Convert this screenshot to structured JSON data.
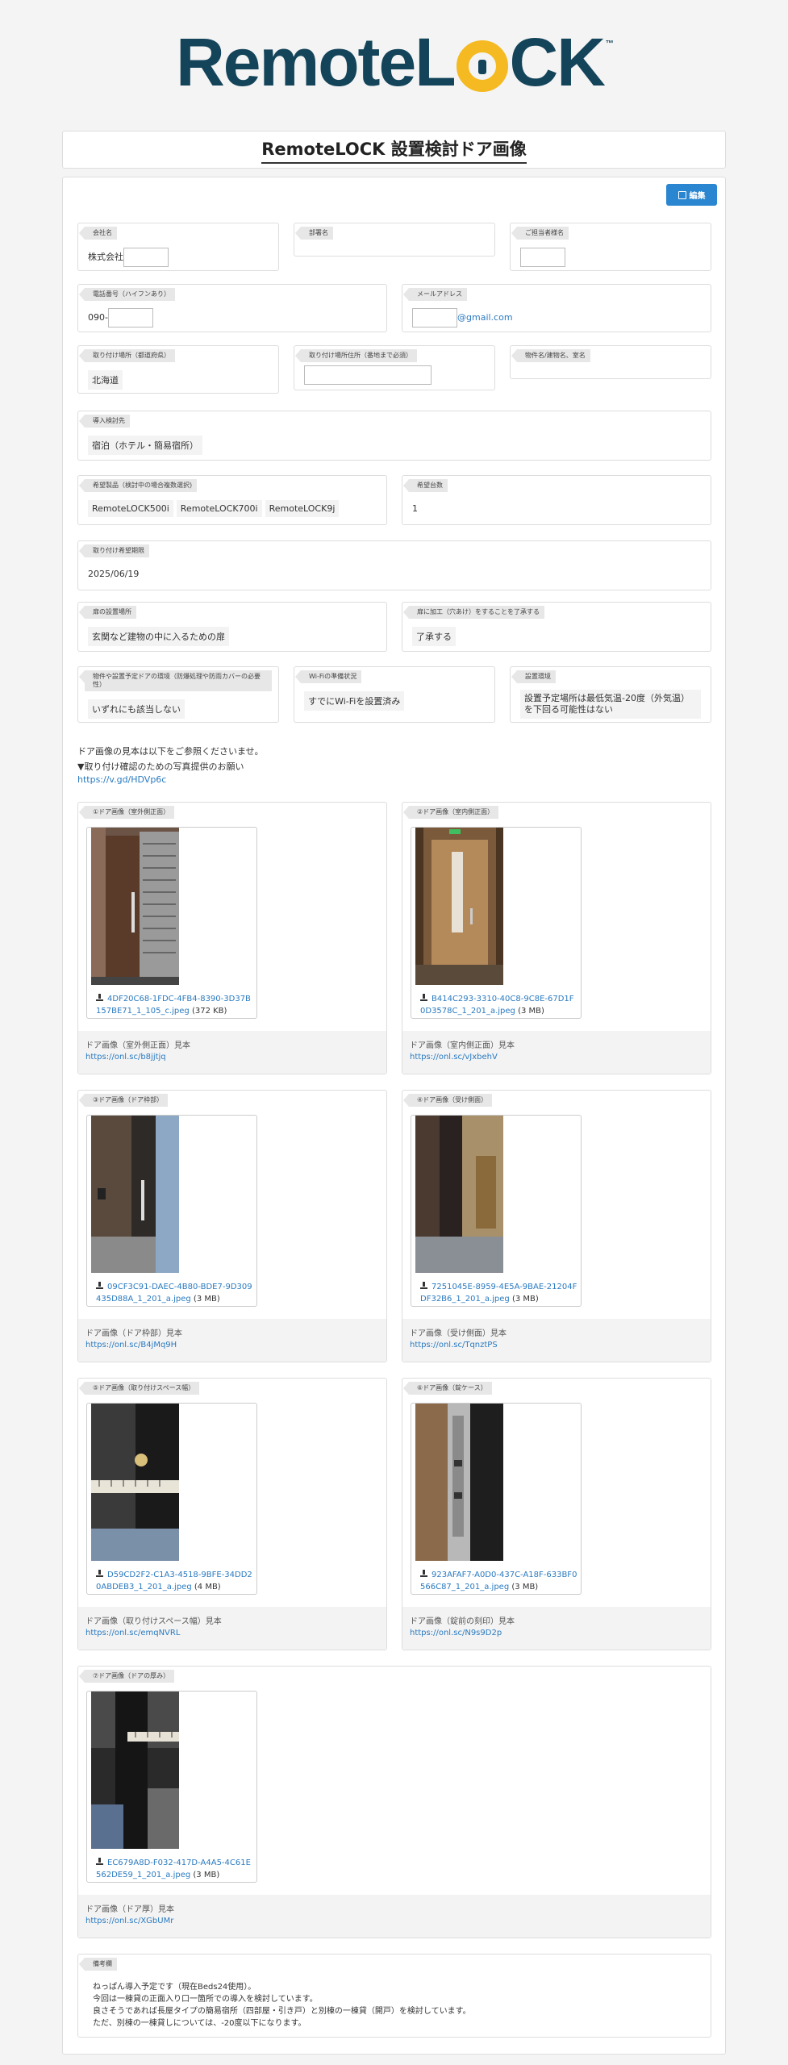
{
  "logo": {
    "remote": "Remote",
    "lock_l": "L",
    "lock_ck": "CK",
    "tm": "™"
  },
  "page_title": "RemoteLOCK 設置検討ドア画像",
  "edit_button": "編集",
  "fields": {
    "company": {
      "label": "会社名",
      "value": "株式会社"
    },
    "department": {
      "label": "部署名",
      "value": ""
    },
    "contact": {
      "label": "ご担当者様名",
      "value": ""
    },
    "phone": {
      "label": "電話番号（ハイフンあり）",
      "value": "090-"
    },
    "email": {
      "label": "メールアドレス",
      "value": "@gmail.com"
    },
    "prefecture": {
      "label": "取り付け場所（都道府県）",
      "value": "北海道"
    },
    "address": {
      "label": "取り付け場所住所（番地まで必須）",
      "value": ""
    },
    "property": {
      "label": "物件名/建物名、室名",
      "value": ""
    },
    "target": {
      "label": "導入検討先",
      "value": "宿泊（ホテル・簡易宿所）"
    },
    "products": {
      "label": "希望製品（検討中の場合複数選択)",
      "values": [
        "RemoteLOCK500i",
        "RemoteLOCK700i",
        "RemoteLOCK9j"
      ]
    },
    "quantity": {
      "label": "希望台数",
      "value": "1"
    },
    "install_date": {
      "label": "取り付け希望期限",
      "value": "2025/06/19"
    },
    "door_location": {
      "label": "扉の設置場所",
      "value": "玄関など建物の中に入るための扉"
    },
    "door_drilling": {
      "label": "扉に加工（穴あけ）をすることを了承する",
      "value": "了承する"
    },
    "environment": {
      "label": "物件や設置予定ドアの環境（防爆処理や防雨カバーの必要性）",
      "value": "いずれにも該当しない"
    },
    "wifi": {
      "label": "Wi-Fiの準備状況",
      "value": "すでにWi-Fiを設置済み"
    },
    "install_env": {
      "label": "設置環境",
      "value": "設置予定場所は最低気温-20度（外気温）を下回る可能性はない"
    }
  },
  "notes": {
    "line1": "ドア画像の見本は以下をご参照くださいませ。",
    "line2": "▼取り付け確認のための写真提供のお願い",
    "link": "https://v.gd/HDVp6c"
  },
  "images": [
    {
      "label": "①ドア画像（室外側正面）",
      "file": "4DF20C68-1FDC-4FB4-8390-3D37B157BE71_1_105_c.jpeg",
      "size": "(372 KB)",
      "sample_title": "ドア画像（室外側正面）見本",
      "sample_link": "https://onl.sc/b8jjtjq"
    },
    {
      "label": "②ドア画像（室内側正面）",
      "file": "B414C293-3310-40C8-9C8E-67D1F0D3578C_1_201_a.jpeg",
      "size": "(3 MB)",
      "sample_title": "ドア画像（室内側正面）見本",
      "sample_link": "https://onl.sc/vJxbehV"
    },
    {
      "label": "③ドア画像（ドア枠部）",
      "file": "09CF3C91-DAEC-4B80-BDE7-9D309435D88A_1_201_a.jpeg",
      "size": "(3 MB)",
      "sample_title": "ドア画像（ドア枠部）見本",
      "sample_link": "https://onl.sc/B4jMq9H"
    },
    {
      "label": "④ドア画像（受け側面）",
      "file": "7251045E-8959-4E5A-9BAE-21204FDF32B6_1_201_a.jpeg",
      "size": "(3 MB)",
      "sample_title": "ドア画像（受け側面）見本",
      "sample_link": "https://onl.sc/TqnztPS"
    },
    {
      "label": "⑤ドア画像（取り付けスペース幅）",
      "file": "D59CD2F2-C1A3-4518-9BFE-34DD20ABDEB3_1_201_a.jpeg",
      "size": "(4 MB)",
      "sample_title": "ドア画像（取り付けスペース幅）見本",
      "sample_link": "https://onl.sc/emqNVRL"
    },
    {
      "label": "⑥ドア画像（錠ケース）",
      "file": "923AFAF7-A0D0-437C-A18F-633BF0566C87_1_201_a.jpeg",
      "size": "(3 MB)",
      "sample_title": "ドア画像（錠前の刻印）見本",
      "sample_link": "https://onl.sc/N9s9D2p"
    },
    {
      "label": "⑦ドア画像（ドアの厚み）",
      "file": "EC679A8D-F032-417D-A4A5-4C61E562DE59_1_201_a.jpeg",
      "size": "(3 MB)",
      "sample_title": "ドア画像（ドア厚）見本",
      "sample_link": "https://onl.sc/XGbUMr"
    }
  ],
  "memo": {
    "label": "備考欄",
    "text": "ねっぱん導入予定です（現在Beds24使用）。\n今回は一棟貸の正面入り口一箇所での導入を検討しています。\n良さそうであれば長屋タイプの簡易宿所（四部屋・引き戸）と別棟の一棟貸（開戸）を検討しています。\nただ、別棟の一棟貸しについては、-20度以下になります。"
  }
}
